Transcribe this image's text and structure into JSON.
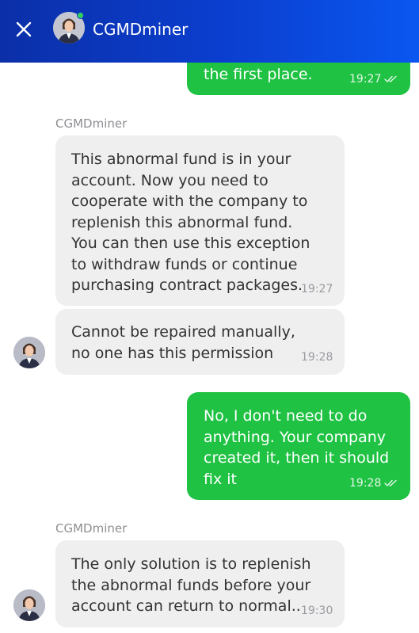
{
  "header": {
    "title": "CGMDminer",
    "accent": "#0b3fd0"
  },
  "messages": [
    {
      "dir": "out",
      "text": "the first place.",
      "time": "19:27"
    },
    {
      "dir": "in",
      "sender": "CGMDminer",
      "text": "This abnormal fund is in your account. Now you need to cooperate with the company to replenish this abnormal fund.\nYou can then use this exception to withdraw funds or continue purchasing contract packages.",
      "time": "19:27"
    },
    {
      "dir": "in",
      "text": "Cannot be repaired manually, no one has this permission",
      "time": "19:28"
    },
    {
      "dir": "out",
      "text": "No, I don't need to do anything. Your company created it, then it should fix it",
      "time": "19:28"
    },
    {
      "dir": "in",
      "sender": "CGMDminer",
      "text": "The only solution is to replenish the abnormal funds before your account can return to normal..",
      "time": "19:30"
    }
  ],
  "colors": {
    "outgoing_bubble": "#1fc243",
    "incoming_bubble": "#efeff0",
    "online_status": "#33d15a"
  }
}
